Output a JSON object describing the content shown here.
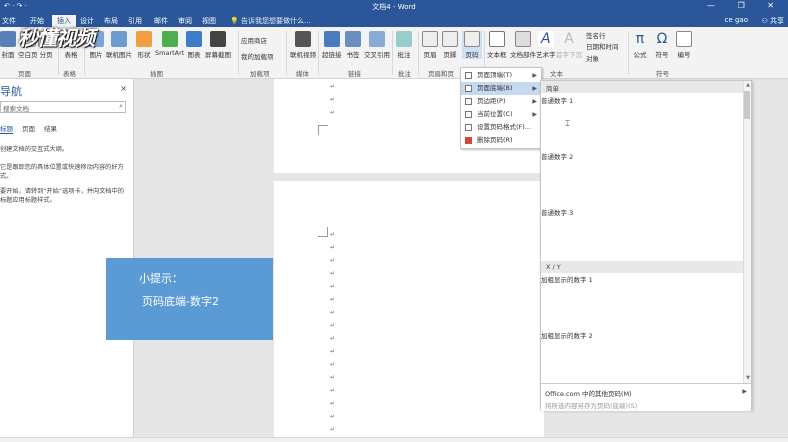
{
  "window": {
    "title": "文档4 - Word",
    "qat": "↶ · ↷ ·",
    "controls": "— ❐ ✕"
  },
  "tabs": [
    {
      "id": "file",
      "label": "文件"
    },
    {
      "id": "home",
      "label": "开始"
    },
    {
      "id": "insert",
      "label": "插入"
    },
    {
      "id": "design",
      "label": "设计"
    },
    {
      "id": "layout",
      "label": "布局"
    },
    {
      "id": "references",
      "label": "引用"
    },
    {
      "id": "mailings",
      "label": "邮件"
    },
    {
      "id": "review",
      "label": "审阅"
    },
    {
      "id": "view",
      "label": "视图"
    }
  ],
  "active_tab": "插入",
  "tellme": "💡 告诉我您想要做什么...",
  "user": "ce gao",
  "share": "⚇ 共享",
  "watermark": "秒懂视频",
  "ribbon": {
    "buttons": [
      {
        "id": "cover",
        "label": "封面"
      },
      {
        "id": "blank",
        "label": "空白页"
      },
      {
        "id": "pagebreak",
        "label": "分页"
      },
      {
        "id": "table",
        "label": "表格"
      },
      {
        "id": "picture",
        "label": "图片"
      },
      {
        "id": "online-pic",
        "label": "联机图片"
      },
      {
        "id": "shapes",
        "label": "形状"
      },
      {
        "id": "smartart",
        "label": "SmartArt"
      },
      {
        "id": "chart",
        "label": "图表"
      },
      {
        "id": "screenshot",
        "label": "屏幕截图"
      },
      {
        "id": "store",
        "label": "应用商店"
      },
      {
        "id": "myaddins",
        "label": "我的加载项"
      },
      {
        "id": "video",
        "label": "联机视频"
      },
      {
        "id": "hyperlink",
        "label": "超链接"
      },
      {
        "id": "bookmark",
        "label": "书签"
      },
      {
        "id": "crossref",
        "label": "交叉引用"
      },
      {
        "id": "comment",
        "label": "批注"
      },
      {
        "id": "header",
        "label": "页眉"
      },
      {
        "id": "footer",
        "label": "页脚"
      },
      {
        "id": "pagenum",
        "label": "页码"
      },
      {
        "id": "textbox",
        "label": "文本框"
      },
      {
        "id": "docparts",
        "label": "文档部件"
      },
      {
        "id": "wordart",
        "label": "艺术字"
      },
      {
        "id": "dropcap",
        "label": "首字下沉"
      },
      {
        "id": "sigline",
        "label": "签名行"
      },
      {
        "id": "datetime",
        "label": "日期和时间"
      },
      {
        "id": "object",
        "label": "对象"
      },
      {
        "id": "equation",
        "label": "公式"
      },
      {
        "id": "symbol",
        "label": "符号"
      },
      {
        "id": "number",
        "label": "编号"
      }
    ],
    "groups": [
      {
        "id": "pages",
        "label": "页面"
      },
      {
        "id": "tables",
        "label": "表格"
      },
      {
        "id": "illustrations",
        "label": "插图"
      },
      {
        "id": "addins",
        "label": "加载项"
      },
      {
        "id": "media",
        "label": "媒体"
      },
      {
        "id": "links",
        "label": "链接"
      },
      {
        "id": "comments",
        "label": "批注"
      },
      {
        "id": "headerfooter",
        "label": "页眉和页"
      },
      {
        "id": "text",
        "label": "文本"
      },
      {
        "id": "symbols",
        "label": "符号"
      }
    ]
  },
  "nav": {
    "title": "导航",
    "close": "×",
    "search_placeholder": "搜索文档",
    "search_icon": "⌕",
    "tabs": [
      {
        "id": "headings",
        "label": "标题"
      },
      {
        "id": "pages",
        "label": "页面"
      },
      {
        "id": "results",
        "label": "结果"
      }
    ],
    "paragraphs": [
      "创建文档的交互式大纲。",
      "它是跟踪您的具体位置或快速移动内容的好方式。",
      "要开始，请转到“开始”选项卡，并向文档中的标题应用标题样式。"
    ]
  },
  "tip": {
    "title": "小提示：",
    "body": "页码底端-数字2"
  },
  "pagenum_menu": {
    "items": [
      {
        "id": "top",
        "label": "页面顶端(T)",
        "arrow": "▶"
      },
      {
        "id": "bottom",
        "label": "页面底端(B)",
        "arrow": "▶"
      },
      {
        "id": "margin",
        "label": "页边距(P)",
        "arrow": "▶"
      },
      {
        "id": "current",
        "label": "当前位置(C)",
        "arrow": "▶"
      },
      {
        "id": "format",
        "label": "设置页码格式(F)...",
        "arrow": ""
      },
      {
        "id": "remove",
        "label": "删除页码(R)",
        "arrow": ""
      }
    ],
    "highlighted": "页面底端(B)"
  },
  "gallery": {
    "section1": "简单",
    "items1": [
      {
        "id": "plain-1",
        "label": "普通数字 1"
      },
      {
        "id": "plain-2",
        "label": "普通数字 2"
      },
      {
        "id": "plain-3",
        "label": "普通数字 3"
      }
    ],
    "section2": "X / Y",
    "items2": [
      {
        "id": "bold-1",
        "label": "加粗显示的数字 1"
      },
      {
        "id": "bold-2",
        "label": "加粗显示的数字 2"
      }
    ],
    "more": "Office.com 中的其他页码(M)",
    "save_selection": "将所选内容另存为页码(底端)(S)",
    "scroll_up": "▲",
    "scroll_down": "▼",
    "more_arrow": "▶",
    "cursor": "⌶"
  }
}
